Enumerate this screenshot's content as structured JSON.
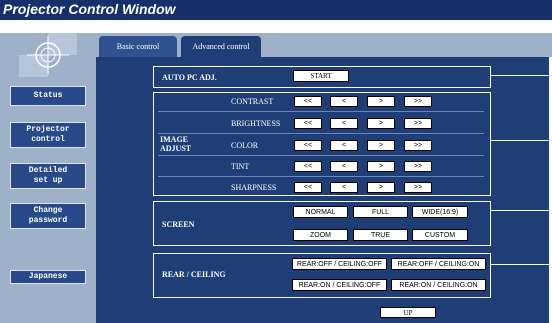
{
  "window": {
    "title": "Projector Control Window"
  },
  "tabs": {
    "basic": "Basic control",
    "advanced": "Advanced control"
  },
  "sidebar": {
    "status": "Status",
    "projector_control": "Projector\ncontrol",
    "detailed_setup": "Detailed\nset up",
    "change_password": "Change\npassword",
    "japanese": "Japanese"
  },
  "auto_pc": {
    "label": "AUTO PC ADJ.",
    "start": "START"
  },
  "image_adjust": {
    "label": "IMAGE\nADJUST",
    "rows": [
      "CONTRAST",
      "BRIGHTNESS",
      "COLOR",
      "TINT",
      "SHARPNESS"
    ],
    "buttons": [
      "<<",
      "<",
      ">",
      ">>"
    ]
  },
  "screen": {
    "label": "SCREEN",
    "options": [
      "NORMAL",
      "FULL",
      "WIDE(16:9)",
      "ZOOM",
      "TRUE",
      "CUSTOM"
    ]
  },
  "rear_ceiling": {
    "label": "REAR / CEILING",
    "options": [
      "REAR:OFF / CEILING:OFF",
      "REAR:OFF / CEILING:ON",
      "REAR:ON / CEILING:OFF",
      "REAR:ON / CEILING:ON"
    ]
  },
  "footer": {
    "up": "UP"
  }
}
